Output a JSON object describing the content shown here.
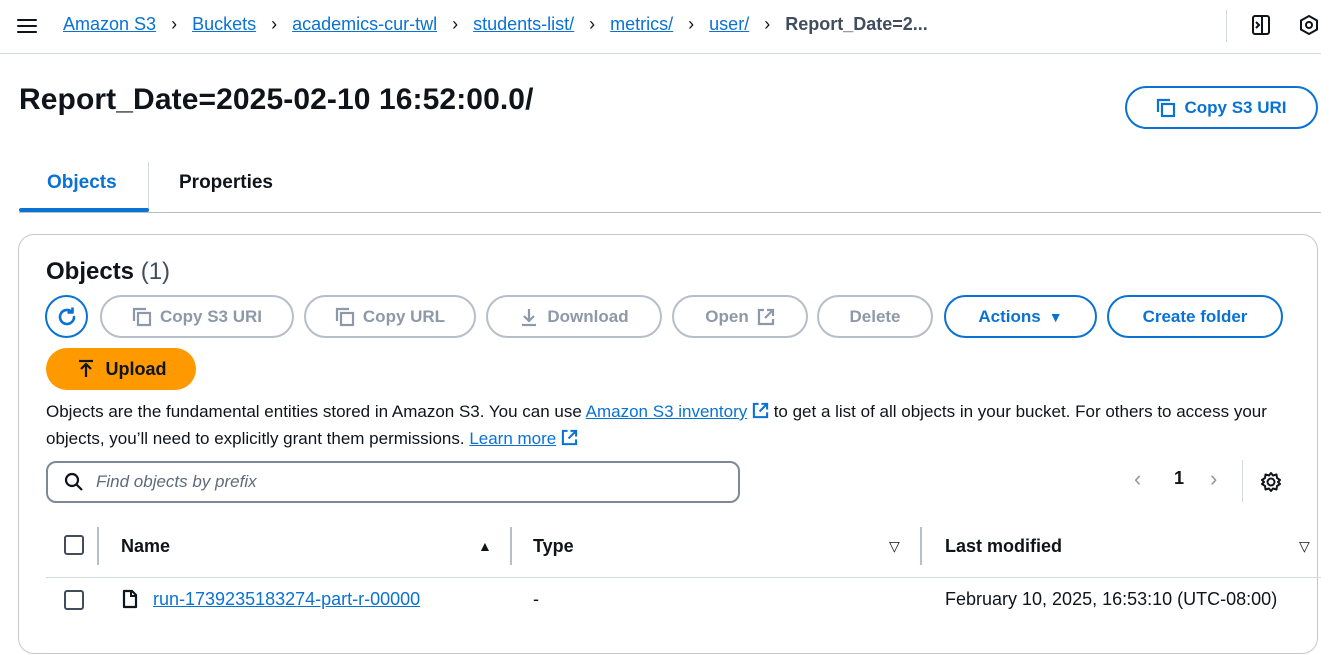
{
  "breadcrumbs": [
    {
      "label": "Amazon S3"
    },
    {
      "label": "Buckets"
    },
    {
      "label": "academics-cur-twl"
    },
    {
      "label": "students-list/"
    },
    {
      "label": "metrics/"
    },
    {
      "label": "user/"
    },
    {
      "label": "Report_Date=2..."
    }
  ],
  "page": {
    "title": "Report_Date=2025-02-10 16:52:00.0/",
    "copy_uri_label": "Copy S3 URI"
  },
  "tabs": [
    {
      "label": "Objects",
      "active": true
    },
    {
      "label": "Properties",
      "active": false
    }
  ],
  "objects_panel": {
    "title": "Objects",
    "count": "(1)",
    "toolbar": {
      "copy_s3_uri": "Copy S3 URI",
      "copy_url": "Copy URL",
      "download": "Download",
      "open": "Open",
      "delete": "Delete",
      "actions": "Actions",
      "create_folder": "Create folder",
      "upload": "Upload"
    },
    "description": {
      "part1": "Objects are the fundamental entities stored in Amazon S3. You can use ",
      "link1": "Amazon S3 inventory",
      "part2": " to get a list of all objects in your bucket. For others to access your objects, you’ll need to explicitly grant them permissions. ",
      "link2": "Learn more"
    },
    "search": {
      "placeholder": "Find objects by prefix",
      "value": ""
    },
    "pagination": {
      "current_page": "1"
    },
    "table": {
      "columns": [
        "Name",
        "Type",
        "Last modified"
      ],
      "rows": [
        {
          "name": "run-1739235183274-part-r-00000",
          "type": "-",
          "last_modified": "February 10, 2025, 16:53:10 (UTC-08:00)"
        }
      ]
    }
  },
  "colors": {
    "accent": "#0972d3",
    "upload": "#ff9900",
    "disabled": "#8d99a8"
  }
}
